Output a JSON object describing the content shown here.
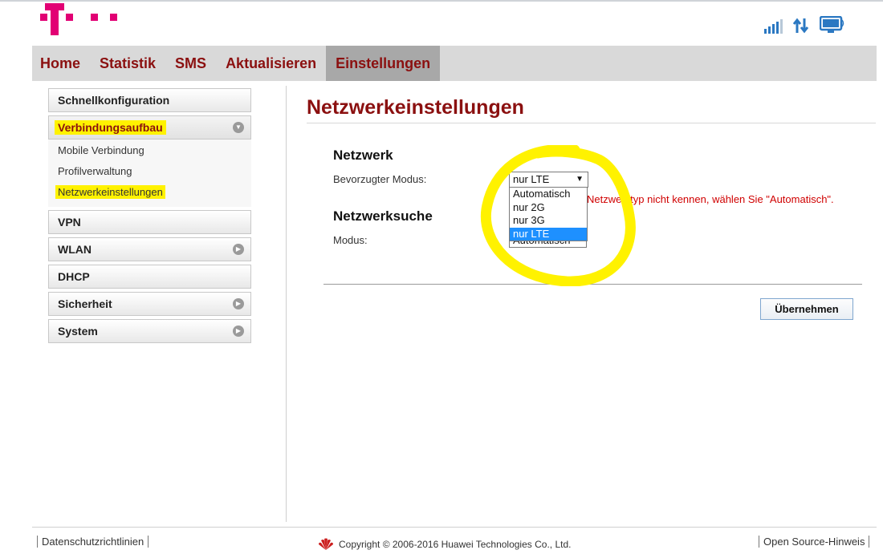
{
  "nav": {
    "items": [
      "Home",
      "Statistik",
      "SMS",
      "Aktualisieren",
      "Einstellungen"
    ],
    "active": "Einstellungen"
  },
  "sidebar": {
    "schnellkonfiguration": "Schnellkonfiguration",
    "verbindungsaufbau": "Verbindungsaufbau",
    "sub": [
      "Mobile Verbindung",
      "Profilverwaltung",
      "Netzwerkeinstellungen"
    ],
    "vpn": "VPN",
    "wlan": "WLAN",
    "dhcp": "DHCP",
    "sicherheit": "Sicherheit",
    "system": "System"
  },
  "content": {
    "title": "Netzwerkeinstellungen",
    "netzwerk": {
      "heading": "Netzwerk",
      "label": "Bevorzugter Modus:",
      "selected": "nur LTE",
      "options": [
        "Automatisch",
        "nur 2G",
        "nur 3G",
        "nur LTE"
      ],
      "hint": "Netzwerktyp nicht kennen, wählen Sie \"Automatisch\"."
    },
    "netzwerksuche": {
      "heading": "Netzwerksuche",
      "label": "Modus:",
      "value": "Automatisch"
    },
    "apply_label": "Übernehmen"
  },
  "footer": {
    "privacy": "Datenschutzrichtlinien",
    "copyright": "Copyright © 2006-2016 Huawei Technologies Co., Ltd.",
    "opensource": "Open Source-Hinweis"
  },
  "colors": {
    "brand_magenta": "#e20074",
    "nav_text": "#8b1010",
    "highlight_yellow": "#fff200",
    "error_red": "#d00000"
  },
  "icons": [
    "telekom-logo",
    "signal-strength-icon",
    "data-transfer-icon",
    "monitor-icon",
    "huawei-logo"
  ]
}
